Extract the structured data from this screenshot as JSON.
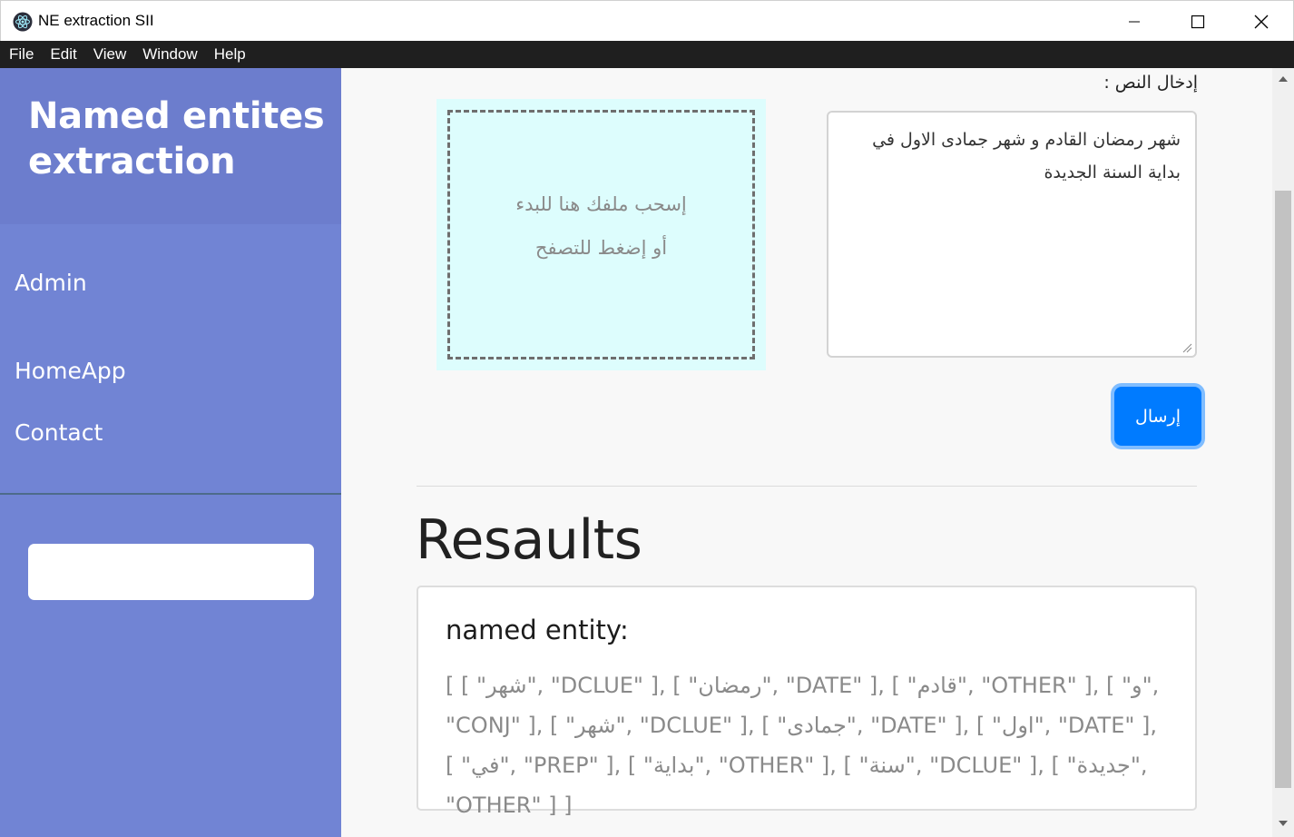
{
  "window": {
    "title": "NE extraction SII"
  },
  "menubar": {
    "items": [
      "File",
      "Edit",
      "View",
      "Window",
      "Help"
    ]
  },
  "sidebar": {
    "brand": "Named entites extraction",
    "nav": {
      "admin": "Admin",
      "home": "HomeApp",
      "contact": "Contact"
    },
    "search_value": ""
  },
  "form": {
    "input_label": "إدخال النص :",
    "dropzone_line1": "إسحب ملفك هنا للبدء",
    "dropzone_line2": "أو إضغط للتصفح",
    "text_value": "شهر رمضان القادم و شهر جمادى الاول في بداية السنة الجديدة",
    "submit_label": "إرسال"
  },
  "results": {
    "title": "Resaults",
    "card_heading": "named entity:",
    "output": "[ [ \"شهر\", \"DCLUE\" ], [ \"رمضان\", \"DATE\" ], [ \"قادم\", \"OTHER\" ], [ \"و\", \"CONJ\" ], [ \"شهر\", \"DCLUE\" ], [ \"جمادى\", \"DATE\" ], [ \"اول\", \"DATE\" ], [ \"في\", \"PREP\" ], [ \"بداية\", \"OTHER\" ], [ \"سنة\", \"DCLUE\" ], [ \"جديدة\", \"OTHER\" ] ]"
  },
  "colors": {
    "sidebar": "#7184d4",
    "sidebar_header": "#6c7dcd",
    "dropzone": "#ddfdfd",
    "primary": "#007bff",
    "menubar": "#1f1f1f"
  }
}
